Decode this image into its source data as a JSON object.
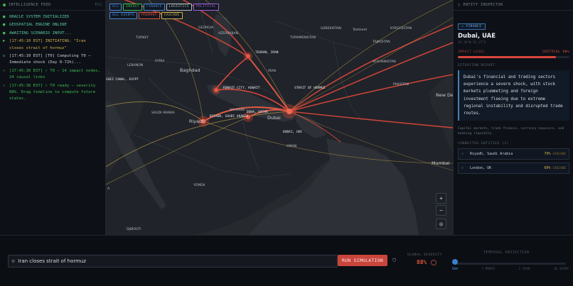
{
  "left_panel": {
    "title": "INTELLIGENCE FEED",
    "esc": "ESC",
    "logs": [
      {
        "mark": "■",
        "text": "ORACLE SYSTEM INITIALIZED",
        "tone": "teal"
      },
      {
        "mark": "■",
        "text": "GEOSPATIAL ENGINE ONLINE",
        "tone": "teal"
      },
      {
        "mark": "■",
        "text": "AWAITING SCENARIO INPUT...",
        "tone": "teal"
      },
      {
        "mark": "▶",
        "text": "[17:45:10 EST] INITIATING: \"Iran closes strait of hormuz\"",
        "tone": "yellow"
      },
      {
        "mark": "↻",
        "text": "[17:45:10 EST] [T0] Computing T0 — Immediate shock (Day 0-72h)...",
        "tone": "plain"
      },
      {
        "mark": "✓",
        "text": "[17:45:36 EST] ✓ T0 — 14 impact nodes, 24 causal links",
        "tone": "green"
      },
      {
        "mark": "✓",
        "text": "[17:45:36 EST] ✓ T0 ready — severity 88%. Drag timeline to compute future states.",
        "tone": "green"
      }
    ]
  },
  "filters": {
    "chips": [
      {
        "label": "ALL",
        "color": "#4a87d8"
      },
      {
        "label": "ENERGY",
        "color": "#3fb950"
      },
      {
        "label": "FINANCE",
        "color": "#4a87d8"
      },
      {
        "label": "LOGISTICS",
        "color": "#b8bec6"
      },
      {
        "label": "POLITICAL",
        "color": "#a060d8"
      },
      {
        "label": "ALL EVENTS",
        "color": "#4a87d8"
      },
      {
        "label": "PRIMARY",
        "color": "#e0553f"
      },
      {
        "label": "CASCADE",
        "color": "#d4b24a"
      }
    ]
  },
  "map": {
    "labels": {
      "georgia": "GEORGIA",
      "azerbaijan": "AZERBAIJAN",
      "uzbekistan": "UZBEKISTAN",
      "tashkent": "Tashkent",
      "kyrgyzstan": "KYRGYZSTAN",
      "turkey": "TURKEY",
      "turkmenistan": "TURKMENISTAN",
      "tajikistan": "TAJIKISTAN",
      "syria": "SYRIA",
      "lebanon": "LEBANON",
      "afghanistan": "AFGHANISTAN",
      "baghdad": "Baghdad",
      "iran": "IRAN",
      "suez": "SUEZ CANAL, EGYPT",
      "kuwait": "KUWAIT CITY, KUWAIT",
      "strait": "STRAIT OF HORMUZ",
      "pakistan": "PAKISTAN",
      "saudi": "SAUDI ARABIA",
      "bahrain": "BAHRAIN",
      "doha": "DOHA, QATAR",
      "riyadh_city": "Riyadh",
      "riyadh_tag": "RIYADH, SAUDI ARABIA",
      "dubai_city": "Dubai",
      "dubai_tag": "DUBAI, UAE",
      "oman": "OMAN",
      "newdelhi": "New De",
      "mumbai": "Mumbai",
      "yemen": "YEMEN",
      "djibouti": "DJIBOUTI",
      "tehran": "TEHRAN, IRAN",
      "a": "A"
    },
    "controls": {
      "zoom_in": "+",
      "zoom_out": "−",
      "globe": "◎"
    }
  },
  "inspector": {
    "title": "ENTITY INSPECTOR",
    "category": "FINANCE",
    "name": "Dubai, UAE",
    "coords": "25.20°N 55.27°E",
    "impact_label": "IMPACT LEVEL",
    "impact_value": "CRITICAL 88%",
    "impact_fraction": 0.88,
    "report_title": "SITUATION REPORT",
    "report": "Dubai's financial and trading sectors experience a severe shock, with stock markets plummeting and foreign investment fleeing due to extreme regional instability and disrupted trade routes.",
    "note": "Capital markets, trade finance, currency exposure, and banking liquidity.",
    "connected_title": "CONNECTED ENTITIES (2)",
    "connected": [
      {
        "name": "Riyadh, Saudi Arabia",
        "pct": "70%",
        "cls": "CASCADE"
      },
      {
        "name": "London, UK",
        "pct": "60%",
        "cls": "CASCADE"
      }
    ]
  },
  "bottom": {
    "scenario_value": "Iran closes strait of hormuz",
    "run_label": "RUN SIMULATION",
    "severity_label": "GLOBAL SEVERITY",
    "severity_value": "88%",
    "timeline_label": "TEMPORAL PROJECTION",
    "ticks": [
      "NOW",
      "1 MONTH",
      "1 YEAR",
      "10 YEARS"
    ]
  }
}
